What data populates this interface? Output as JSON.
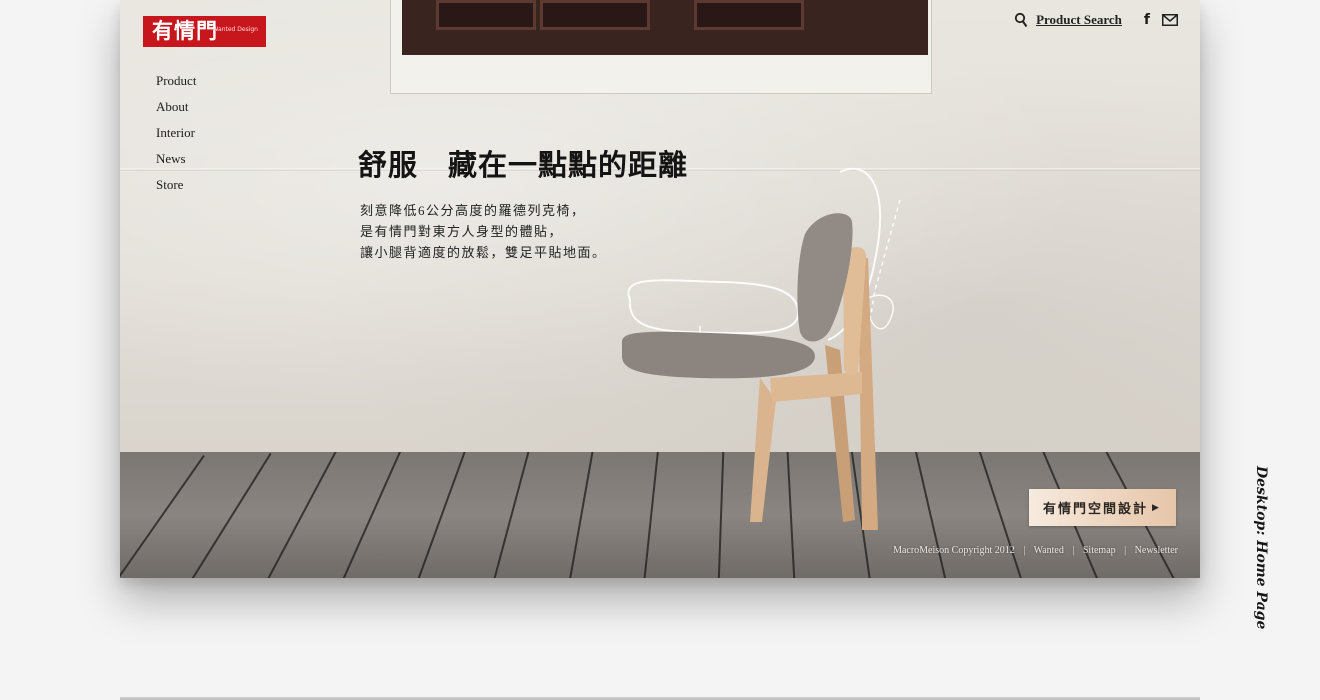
{
  "brand": {
    "logo_text": "有情門",
    "logo_subtext": "Wanted Design",
    "logo_color": "#c8161d"
  },
  "nav": {
    "items": [
      "Product",
      "About",
      "Interior",
      "News",
      "Store"
    ]
  },
  "header": {
    "search_label": "Product Search",
    "icons": [
      "search-icon",
      "facebook-icon",
      "mail-icon"
    ]
  },
  "hero": {
    "headline": "舒服　藏在一點點的距離",
    "body_lines": [
      "刻意降低6公分高度的羅德列克椅，",
      "是有情門對東方人身型的體貼，",
      "讓小腿背適度的放鬆，雙足平貼地面。"
    ]
  },
  "cta": {
    "label": "有情門空間設計",
    "icon": "play-arrow-icon"
  },
  "footer": {
    "copyright": "MacroMeison Copyright 2012",
    "links": [
      "Wanted",
      "Sitemap",
      "Newsletter"
    ]
  },
  "side_caption": "Desktop: Home Page"
}
